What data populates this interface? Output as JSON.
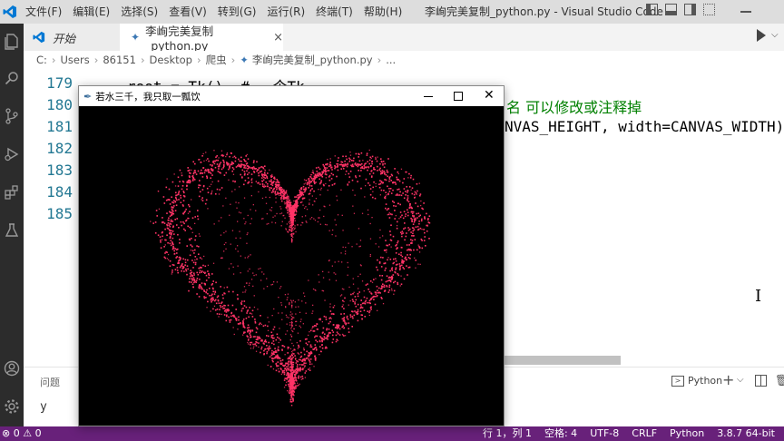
{
  "window": {
    "title": "李峋完美复制_python.py - Visual Studio Code",
    "menu": [
      "文件(F)",
      "编辑(E)",
      "选择(S)",
      "查看(V)",
      "转到(G)",
      "运行(R)",
      "终端(T)",
      "帮助(H)"
    ]
  },
  "tabs": [
    {
      "label": "开始",
      "active": false
    },
    {
      "label": "李峋完美复制_python.py",
      "active": true,
      "close": "×"
    }
  ],
  "breadcrumb": [
    "C:",
    "Users",
    "86151",
    "Desktop",
    "爬虫",
    "李峋完美复制_python.py",
    "..."
  ],
  "editor": {
    "line_numbers": [
      "179",
      "180",
      "181",
      "182",
      "183",
      "184",
      "185"
    ],
    "code_line_179": "root = Tk()  # 一个Tk",
    "code_line_180_comment": "名 可以修改或注释掉",
    "code_line_181": "NVAS_HEIGHT, width=CANVAS_WIDTH)"
  },
  "panel": {
    "problems_label": "问题",
    "terminal_output": "y",
    "terminal_name": "Python",
    "plus": "+"
  },
  "statusbar": {
    "errors": "⊗ 0",
    "warnings": "⚠ 0",
    "position": "行 1，列 1",
    "spaces": "空格: 4",
    "encoding": "UTF-8",
    "eol": "CRLF",
    "language": "Python",
    "interpreter": "3.8.7 64-bit"
  },
  "tk_window": {
    "title": "若水三千，我只取一瓢饮",
    "canvas_color": "#000000",
    "heart_color": "#ff3366"
  },
  "colors": {
    "statusbar": "#68217a",
    "activitybar": "#2c2c2c",
    "titlebar": "#dddddd"
  }
}
